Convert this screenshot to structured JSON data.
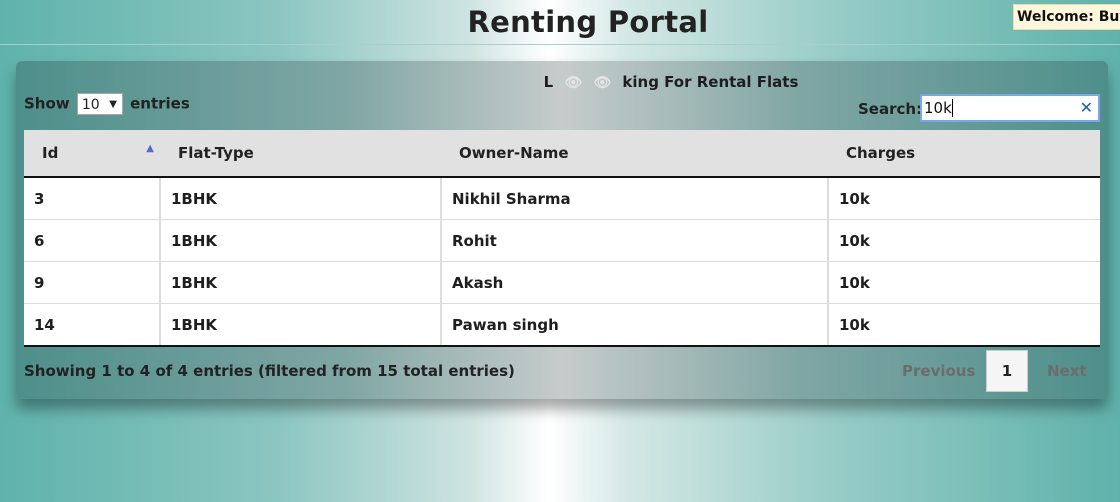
{
  "header": {
    "title": "Renting Portal",
    "welcome": "Welcome: Buy"
  },
  "panel": {
    "caption_start": "L",
    "caption_end": "king For Rental Flats",
    "caption_icons": [
      "eye-icon",
      "eye-icon"
    ],
    "show_label": "Show",
    "entries_label": "entries",
    "page_size": "10",
    "search_label": "Search:",
    "search_value": "10k"
  },
  "table": {
    "columns": [
      "Id",
      "Flat-Type",
      "Owner-Name",
      "Charges"
    ],
    "sorted_column": "Id",
    "rows": [
      [
        "3",
        "1BHK",
        "Nikhil Sharma",
        "10k"
      ],
      [
        "6",
        "1BHK",
        "Rohit",
        "10k"
      ],
      [
        "9",
        "1BHK",
        "Akash",
        "10k"
      ],
      [
        "14",
        "1BHK",
        "Pawan singh",
        "10k"
      ]
    ]
  },
  "footer": {
    "info": "Showing 1 to 4 of 4 entries (filtered from 15 total entries)",
    "previous": "Previous",
    "current_page": "1",
    "next": "Next"
  }
}
